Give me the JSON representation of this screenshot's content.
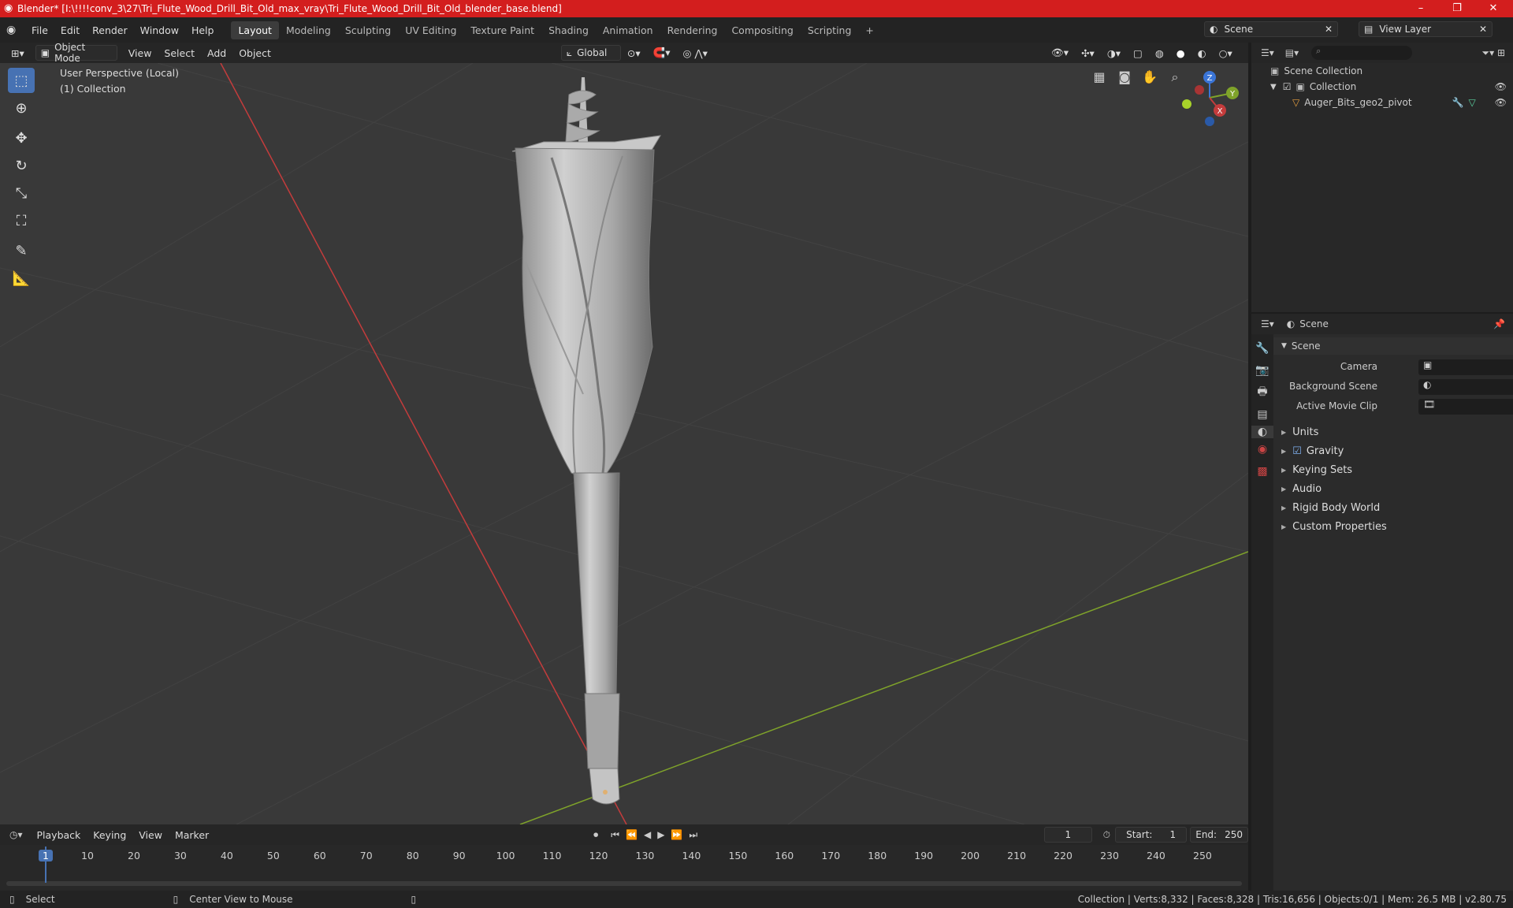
{
  "window": {
    "title": "Blender* [I:\\!!!!conv_3\\27\\Tri_Flute_Wood_Drill_Bit_Old_max_vray\\Tri_Flute_Wood_Drill_Bit_Old_blender_base.blend]",
    "minimize": "–",
    "maximize": "❐",
    "close": "✕"
  },
  "menu": {
    "file": "File",
    "edit": "Edit",
    "render": "Render",
    "window": "Window",
    "help": "Help"
  },
  "workspaces": [
    "Layout",
    "Modeling",
    "Sculpting",
    "UV Editing",
    "Texture Paint",
    "Shading",
    "Animation",
    "Rendering",
    "Compositing",
    "Scripting"
  ],
  "active_workspace": "Layout",
  "add_workspace": "+",
  "scene_selector": "Scene",
  "view_layer_selector": "View Layer",
  "viewport_header": {
    "mode": "Object Mode",
    "view": "View",
    "select": "Select",
    "add": "Add",
    "object": "Object",
    "orientation": "Global"
  },
  "viewport": {
    "perspective": "User Perspective (Local)",
    "collection": "(1) Collection"
  },
  "gizmo": {
    "z": "Z",
    "y": "Y",
    "x": "X"
  },
  "outliner": {
    "root": "Scene Collection",
    "collection": "Collection",
    "object": "Auger_Bits_geo2_pivot"
  },
  "properties": {
    "context": "Scene",
    "panel": "Scene",
    "camera_label": "Camera",
    "background_scene_label": "Background Scene",
    "active_movie_clip_label": "Active Movie Clip",
    "subpanels": [
      "Units",
      "Gravity",
      "Keying Sets",
      "Audio",
      "Rigid Body World",
      "Custom Properties"
    ]
  },
  "timeline": {
    "playback": "Playback",
    "keying": "Keying",
    "view": "View",
    "marker": "Marker",
    "current_frame": "1",
    "start_label": "Start:",
    "start": "1",
    "end_label": "End:",
    "end": "250",
    "ticks": [
      "1",
      "10",
      "20",
      "30",
      "40",
      "50",
      "60",
      "70",
      "80",
      "90",
      "100",
      "110",
      "120",
      "130",
      "140",
      "150",
      "160",
      "170",
      "180",
      "190",
      "200",
      "210",
      "220",
      "230",
      "240",
      "250"
    ]
  },
  "statusbar": {
    "select": "Select",
    "center_view": "Center View to Mouse",
    "stats": "Collection | Verts:8,332 | Faces:8,328 | Tris:16,656 | Objects:0/1 | Mem: 26.5 MB | v2.80.75"
  },
  "colors": {
    "titlebar": "#d31e1e",
    "accent": "#4772b3",
    "x_axis": "#c43c3c",
    "y_axis": "#7fa32a"
  }
}
